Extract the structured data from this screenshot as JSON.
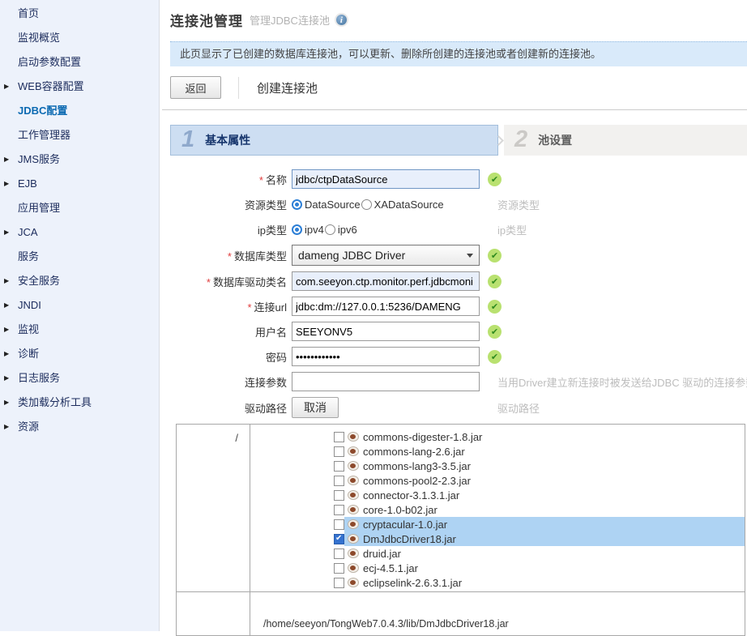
{
  "sidebar": {
    "items": [
      {
        "label": "首页",
        "arrow": false,
        "active": false
      },
      {
        "label": "监视概览",
        "arrow": false,
        "active": false
      },
      {
        "label": "启动参数配置",
        "arrow": false,
        "active": false
      },
      {
        "label": "WEB容器配置",
        "arrow": true,
        "active": false
      },
      {
        "label": "JDBC配置",
        "arrow": false,
        "active": true
      },
      {
        "label": "工作管理器",
        "arrow": false,
        "active": false
      },
      {
        "label": "JMS服务",
        "arrow": true,
        "active": false
      },
      {
        "label": "EJB",
        "arrow": true,
        "active": false
      },
      {
        "label": "应用管理",
        "arrow": false,
        "active": false
      },
      {
        "label": "JCA",
        "arrow": true,
        "active": false
      },
      {
        "label": "服务",
        "arrow": false,
        "active": false
      },
      {
        "label": "安全服务",
        "arrow": true,
        "active": false
      },
      {
        "label": "JNDI",
        "arrow": true,
        "active": false
      },
      {
        "label": "监视",
        "arrow": true,
        "active": false
      },
      {
        "label": "诊断",
        "arrow": true,
        "active": false
      },
      {
        "label": "日志服务",
        "arrow": true,
        "active": false
      },
      {
        "label": "类加载分析工具",
        "arrow": true,
        "active": false
      },
      {
        "label": "资源",
        "arrow": true,
        "active": false
      }
    ]
  },
  "header": {
    "title": "连接池管理",
    "subtitle": "管理JDBC连接池",
    "info_icon": "i"
  },
  "notice": {
    "text": "此页显示了已创建的数据库连接池，可以更新、删除所创建的连接池或者创建新的连接池。"
  },
  "toolbar": {
    "back_label": "返回",
    "create_label": "创建连接池"
  },
  "wizard": {
    "steps": [
      {
        "num": "1",
        "label": "基本属性",
        "active": true
      },
      {
        "num": "2",
        "label": "池设置",
        "active": false
      }
    ]
  },
  "form": {
    "required_marker": "*",
    "rows": {
      "name": {
        "label": "名称",
        "value": "jdbc/ctpDataSource",
        "valid": true
      },
      "resource_type": {
        "label": "资源类型",
        "options": [
          "DataSource",
          "XADataSource"
        ],
        "selected": "DataSource",
        "hint": "资源类型"
      },
      "ip_type": {
        "label": "ip类型",
        "options": [
          "ipv4",
          "ipv6"
        ],
        "selected": "ipv4",
        "hint": "ip类型"
      },
      "db_type": {
        "label": "数据库类型",
        "value": "dameng JDBC Driver",
        "valid": true
      },
      "driver_class": {
        "label": "数据库驱动类名",
        "value": "com.seeyon.ctp.monitor.perf.jdbcmoni",
        "valid": true
      },
      "url": {
        "label": "连接url",
        "value": "jdbc:dm://127.0.0.1:5236/DAMENG",
        "valid": true
      },
      "username": {
        "label": "用户名",
        "value": "SEEYONV5",
        "valid": true
      },
      "password": {
        "label": "密码",
        "value": "••••••••••••",
        "valid": true
      },
      "conn_params": {
        "label": "连接参数",
        "value": "",
        "hint": "当用Driver建立新连接时被发送给JDBC 驱动的连接参数，"
      },
      "driver_path": {
        "label": "驱动路径",
        "button_label": "取消",
        "hint": "驱动路径"
      }
    },
    "valid_icon": "✔"
  },
  "file_browser": {
    "root_label": "/",
    "files": [
      {
        "name": "commons-digester-1.8.jar",
        "checked": false,
        "highlighted": false
      },
      {
        "name": "commons-lang-2.6.jar",
        "checked": false,
        "highlighted": false
      },
      {
        "name": "commons-lang3-3.5.jar",
        "checked": false,
        "highlighted": false
      },
      {
        "name": "commons-pool2-2.3.jar",
        "checked": false,
        "highlighted": false
      },
      {
        "name": "connector-3.1.3.1.jar",
        "checked": false,
        "highlighted": false
      },
      {
        "name": "core-1.0-b02.jar",
        "checked": false,
        "highlighted": false
      },
      {
        "name": "cryptacular-1.0.jar",
        "checked": false,
        "highlighted": true
      },
      {
        "name": "DmJdbcDriver18.jar",
        "checked": true,
        "highlighted": true
      },
      {
        "name": "druid.jar",
        "checked": false,
        "highlighted": false
      },
      {
        "name": "ecj-4.5.1.jar",
        "checked": false,
        "highlighted": false
      },
      {
        "name": "eclipselink-2.6.3.1.jar",
        "checked": false,
        "highlighted": false
      }
    ],
    "selected_path": "/home/seeyon/TongWeb7.0.4.3/lib/DmJdbcDriver18.jar"
  },
  "colors": {
    "sidebar_bg": "#edf2fb",
    "active_nav": "#0c6ab2",
    "notice_bg": "#d9eafa",
    "step_active_bg": "#cddef2",
    "step_inactive_bg": "#f2f1ef",
    "valid_badge_bg": "#b9e170",
    "valid_badge_fg": "#2f8a1f",
    "row_highlight": "#aed3f3",
    "checkbox_checked": "#3472cf",
    "input_hint": "#bdbdbd"
  }
}
